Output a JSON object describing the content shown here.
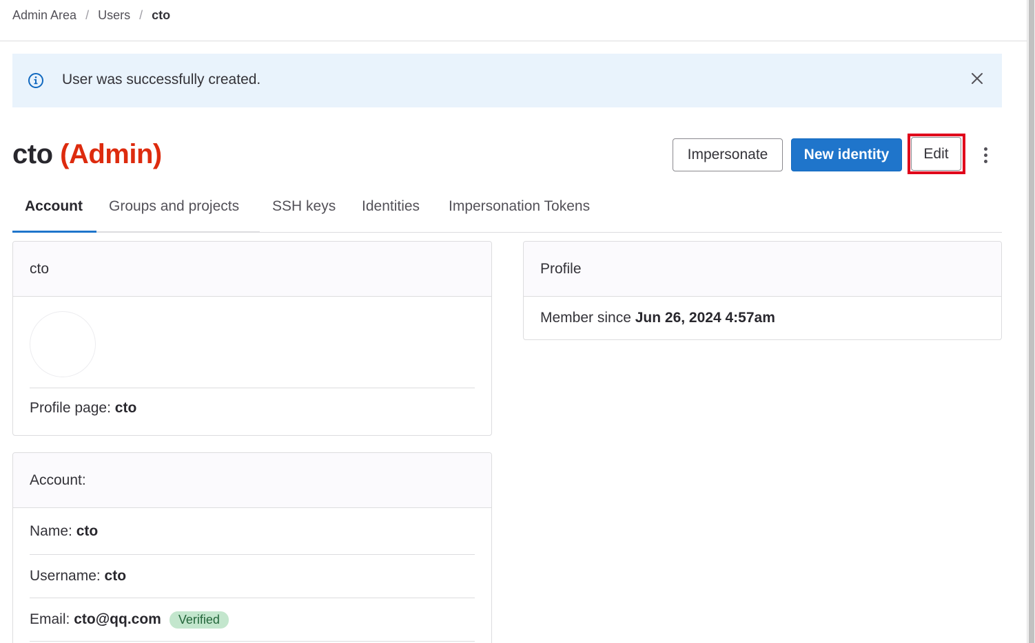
{
  "breadcrumb": {
    "items": [
      "Admin Area",
      "Users"
    ],
    "current": "cto",
    "separator": "/"
  },
  "alert": {
    "message": "User was successfully created.",
    "icon": "info-icon",
    "close_icon": "close-icon"
  },
  "header": {
    "title": "cto",
    "role": "(Admin)",
    "buttons": {
      "impersonate": "Impersonate",
      "new_identity": "New identity",
      "edit": "Edit"
    }
  },
  "tabs": [
    {
      "label": "Account",
      "active": true
    },
    {
      "label": "Groups and projects"
    },
    {
      "label": "SSH keys"
    },
    {
      "label": "Identities"
    },
    {
      "label": "Impersonation Tokens"
    }
  ],
  "user_card": {
    "title": "cto",
    "profile_page_label": "Profile page:",
    "profile_page_value": "cto"
  },
  "profile_card": {
    "title": "Profile",
    "member_since_label": "Member since",
    "member_since_value": "Jun 26, 2024 4:57am"
  },
  "account_card": {
    "title": "Account:",
    "name_label": "Name:",
    "name_value": "cto",
    "username_label": "Username:",
    "username_value": "cto",
    "email_label": "Email:",
    "email_value": "cto@qq.com",
    "email_badge": "Verified"
  },
  "colors": {
    "primary": "#1f75cb",
    "admin_red": "#dd2b0e",
    "alert_bg": "#e9f3fc",
    "verified_bg": "#c3e6cd",
    "highlight": "#e0001b"
  }
}
